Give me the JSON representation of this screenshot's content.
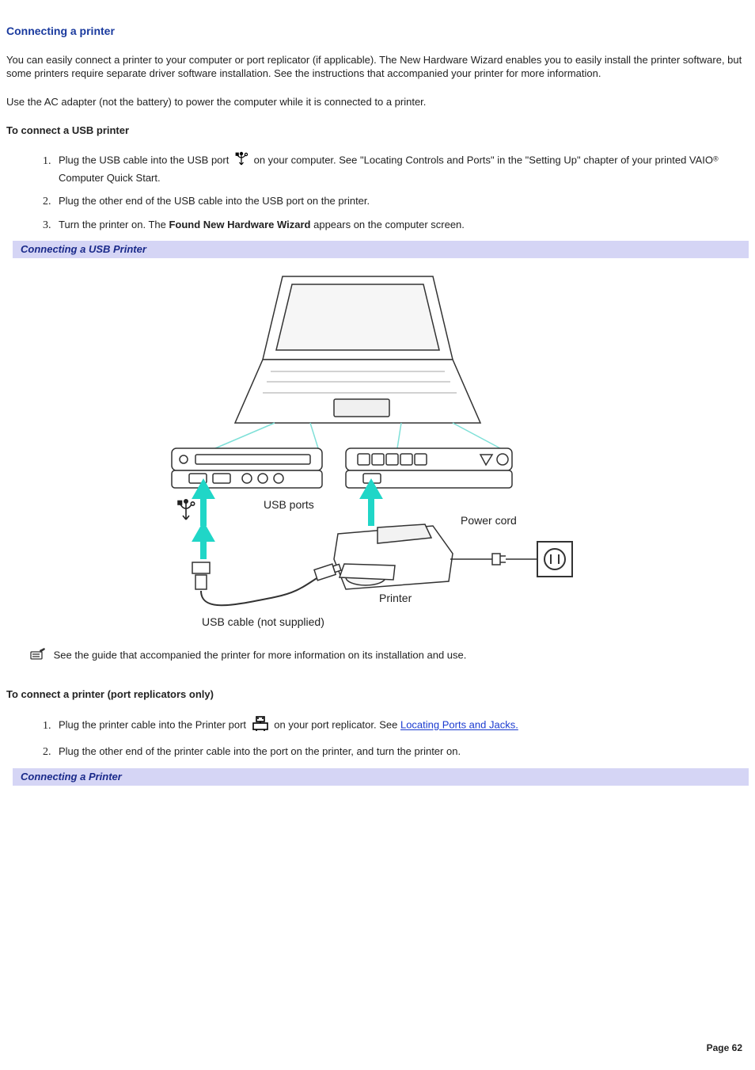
{
  "heading": "Connecting a printer",
  "intro1": "You can easily connect a printer to your computer or port replicator (if applicable). The New Hardware Wizard enables you to easily install the printer software, but some printers require separate driver software installation. See the instructions that accompanied your printer for more information.",
  "intro2": "Use the AC adapter (not the battery) to power the computer while it is connected to a printer.",
  "section_usb_title": "To connect a USB printer",
  "steps_usb": {
    "s1a": "Plug the USB cable into the USB port ",
    "s1b": " on your computer. See \"Locating Controls and Ports\" in the \"Setting Up\" chapter of your printed VAIO",
    "s1c": " Computer Quick Start.",
    "s2": "Plug the other end of the USB cable into the USB port on the printer.",
    "s3a": "Turn the printer on. The ",
    "s3b": "Found New Hardware Wizard",
    "s3c": " appears on the computer screen."
  },
  "caption1": "Connecting a USB Printer",
  "fig_labels": {
    "usb_ports": "USB ports",
    "power_cord": "Power cord",
    "printer": "Printer",
    "usb_cable": "USB cable (not supplied)"
  },
  "note_text": "See the guide that accompanied the printer for more information on its installation and use.",
  "section_rep_title": "To connect a printer (port replicators only)",
  "steps_rep": {
    "s1a": "Plug the printer cable into the Printer port ",
    "s1b": " on your port replicator. See ",
    "s1link": "Locating Ports and Jacks.",
    "s2": "Plug the other end of the printer cable into the port on the printer, and turn the printer on."
  },
  "caption2": "Connecting a Printer",
  "page_number": "Page 62"
}
